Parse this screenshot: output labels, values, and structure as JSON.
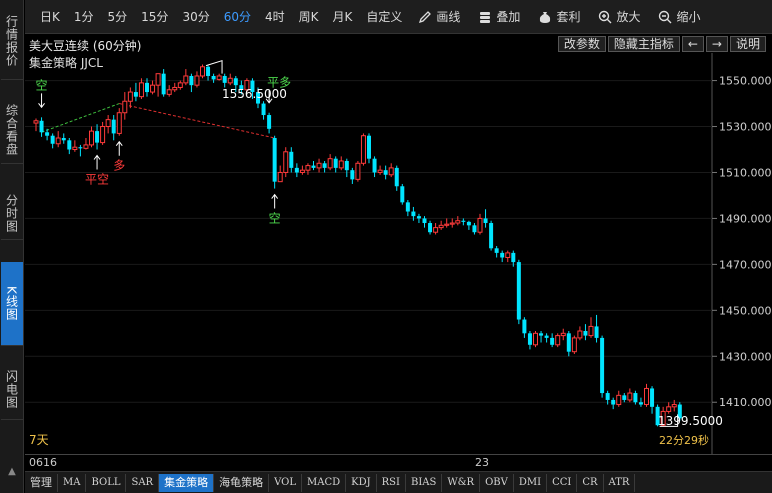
{
  "left_nav": {
    "items": [
      {
        "label": "行情报价",
        "active": false
      },
      {
        "label": "综合看盘",
        "active": false
      },
      {
        "label": "分时图",
        "active": false
      },
      {
        "label": "K线图",
        "active": true
      },
      {
        "label": "闪电图",
        "active": false
      }
    ]
  },
  "toolbar": {
    "periods": [
      "日K",
      "1分",
      "5分",
      "15分",
      "30分",
      "60分",
      "4时",
      "周K",
      "月K",
      "自定义"
    ],
    "active_period": "60分",
    "tools": [
      {
        "label": "画线",
        "icon": "pencil-icon"
      },
      {
        "label": "叠加",
        "icon": "stack-icon"
      },
      {
        "label": "套利",
        "icon": "moneybag-icon"
      },
      {
        "label": "放大",
        "icon": "zoom-in-icon"
      },
      {
        "label": "缩小",
        "icon": "zoom-out-icon"
      }
    ]
  },
  "header": {
    "title": "美大豆连续 (60分钟)",
    "buttons": [
      "改参数",
      "隐藏主指标",
      "←",
      "→",
      "说明"
    ]
  },
  "strategy_label": "集金策略 JJCL",
  "period_label": "7天",
  "countdown": "22分29秒",
  "peak_label": "1556.5000",
  "last_label": "1399.5000",
  "date_axis": {
    "start": "0616",
    "mid": "23"
  },
  "bottom_tabs": {
    "items": [
      "管理",
      "MA",
      "BOLL",
      "SAR",
      "集金策略",
      "海龟策略",
      "VOL",
      "MACD",
      "KDJ",
      "RSI",
      "BIAS",
      "W&R",
      "OBV",
      "DMI",
      "CCI",
      "CR",
      "ATR"
    ],
    "active": "集金策略"
  },
  "colors": {
    "up": "#ff3b3b",
    "down": "#00e5ff",
    "signal_short": "#4dd84d",
    "signal_long": "#ff3b3b",
    "accent": "#1e72c8"
  },
  "chart_data": {
    "type": "candlestick",
    "title": "美大豆连续 (60分钟)",
    "ylim": [
      1394,
      1562
    ],
    "yticks": [
      "1550.0000",
      "1530.0000",
      "1510.0000",
      "1490.0000",
      "1470.0000",
      "1450.0000",
      "1430.0000",
      "1410.0000"
    ],
    "high_marker": 1556.5,
    "low_marker": 1399.5,
    "signals": [
      {
        "label": "空",
        "bar": 1,
        "side": "short"
      },
      {
        "label": "平空",
        "bar": 11,
        "side": "long"
      },
      {
        "label": "多",
        "bar": 15,
        "side": "long"
      },
      {
        "label": "平多",
        "bar": 42,
        "side": "short"
      },
      {
        "label": "空",
        "bar": 43,
        "side": "short"
      }
    ],
    "candles": [
      [
        1531.5,
        1532.5,
        1528,
        1533.5
      ],
      [
        1532.5,
        1527.5,
        1525.5,
        1534
      ],
      [
        1527.5,
        1526,
        1524,
        1529
      ],
      [
        1526,
        1522.5,
        1520.5,
        1527
      ],
      [
        1522.5,
        1525,
        1521,
        1528
      ],
      [
        1525,
        1524,
        1522.5,
        1527
      ],
      [
        1524,
        1520,
        1518,
        1525
      ],
      [
        1520,
        1521,
        1519,
        1524
      ],
      [
        1521,
        1520.5,
        1517,
        1522
      ],
      [
        1520.5,
        1522,
        1520,
        1525
      ],
      [
        1522,
        1528,
        1521,
        1530
      ],
      [
        1528,
        1523,
        1520,
        1531
      ],
      [
        1523,
        1530,
        1522,
        1532
      ],
      [
        1530,
        1533,
        1527,
        1535
      ],
      [
        1533,
        1527,
        1524,
        1535
      ],
      [
        1527,
        1536,
        1526,
        1538
      ],
      [
        1536,
        1541,
        1533,
        1545
      ],
      [
        1541,
        1545,
        1538,
        1547
      ],
      [
        1545,
        1543,
        1541,
        1549
      ],
      [
        1543,
        1549,
        1542,
        1551
      ],
      [
        1549,
        1545,
        1543,
        1551
      ],
      [
        1545,
        1548,
        1544,
        1550
      ],
      [
        1548,
        1553,
        1543,
        1553
      ],
      [
        1553,
        1544,
        1543,
        1555
      ],
      [
        1544,
        1546,
        1543,
        1548
      ],
      [
        1546,
        1547,
        1545,
        1549
      ],
      [
        1547,
        1549,
        1546,
        1550
      ],
      [
        1549,
        1552,
        1548,
        1555
      ],
      [
        1552,
        1548,
        1545,
        1553
      ],
      [
        1548,
        1552,
        1547,
        1554
      ],
      [
        1552,
        1556,
        1551,
        1557
      ],
      [
        1556,
        1552,
        1550,
        1556.5
      ],
      [
        1552,
        1550.5,
        1549,
        1553
      ],
      [
        1550.5,
        1552,
        1550,
        1553
      ],
      [
        1552,
        1549,
        1547,
        1553
      ],
      [
        1549,
        1551,
        1548,
        1553
      ],
      [
        1551,
        1548,
        1545,
        1552
      ],
      [
        1548,
        1546,
        1544,
        1550
      ],
      [
        1546,
        1550,
        1545,
        1551
      ],
      [
        1550,
        1545,
        1542,
        1551
      ],
      [
        1545,
        1540,
        1538,
        1547
      ],
      [
        1540,
        1535,
        1533,
        1541
      ],
      [
        1535,
        1529,
        1527,
        1536
      ],
      [
        1525,
        1506,
        1503,
        1526
      ],
      [
        1506,
        1510,
        1506,
        1513
      ],
      [
        1510,
        1519,
        1508,
        1521
      ],
      [
        1519,
        1512,
        1510,
        1521
      ],
      [
        1512,
        1510,
        1508,
        1514
      ],
      [
        1510,
        1511,
        1509,
        1513
      ],
      [
        1511,
        1513,
        1509,
        1514
      ],
      [
        1513,
        1512,
        1511,
        1515
      ],
      [
        1512,
        1514,
        1510,
        1516
      ],
      [
        1514,
        1512,
        1510,
        1515
      ],
      [
        1512,
        1516,
        1511,
        1518
      ],
      [
        1516,
        1512,
        1510,
        1517
      ],
      [
        1512,
        1515,
        1511,
        1517
      ],
      [
        1515,
        1511,
        1508,
        1516
      ],
      [
        1511,
        1507,
        1505,
        1512
      ],
      [
        1507,
        1514,
        1506,
        1515
      ],
      [
        1514,
        1526,
        1513,
        1527
      ],
      [
        1526,
        1516,
        1514,
        1527
      ],
      [
        1516,
        1510,
        1508,
        1517
      ],
      [
        1510,
        1511,
        1509,
        1513
      ],
      [
        1511,
        1509,
        1507,
        1513
      ],
      [
        1509,
        1512,
        1508,
        1514
      ],
      [
        1512,
        1504,
        1502,
        1513
      ],
      [
        1504,
        1497,
        1496,
        1505
      ],
      [
        1497,
        1493,
        1491,
        1498
      ],
      [
        1493,
        1491,
        1489,
        1495
      ],
      [
        1491,
        1490,
        1488,
        1492
      ],
      [
        1490,
        1488,
        1486,
        1491
      ],
      [
        1488,
        1484,
        1483,
        1489
      ],
      [
        1484,
        1486,
        1483,
        1488
      ],
      [
        1486,
        1487,
        1485,
        1489
      ],
      [
        1487,
        1487.5,
        1486,
        1490
      ],
      [
        1487.5,
        1488,
        1486,
        1490
      ],
      [
        1488,
        1489,
        1487,
        1491
      ],
      [
        1489,
        1488.5,
        1487,
        1490
      ],
      [
        1488.5,
        1487,
        1485,
        1489
      ],
      [
        1487,
        1484,
        1483,
        1488
      ],
      [
        1484,
        1490,
        1483,
        1492
      ],
      [
        1490,
        1488,
        1486,
        1494
      ],
      [
        1488,
        1477,
        1476,
        1489
      ],
      [
        1477,
        1475,
        1473,
        1478
      ],
      [
        1475,
        1473,
        1471,
        1476
      ],
      [
        1473,
        1475,
        1471,
        1476
      ],
      [
        1475,
        1471,
        1469,
        1476
      ],
      [
        1471,
        1446,
        1444,
        1472
      ],
      [
        1446,
        1440,
        1438,
        1447
      ],
      [
        1440,
        1435,
        1433,
        1441
      ],
      [
        1435,
        1440,
        1434,
        1441
      ],
      [
        1440,
        1439,
        1436,
        1441
      ],
      [
        1439,
        1438,
        1436,
        1440
      ],
      [
        1438,
        1435,
        1434,
        1440
      ],
      [
        1435,
        1439,
        1434,
        1440
      ],
      [
        1439,
        1440,
        1437,
        1442
      ],
      [
        1440,
        1432,
        1430,
        1441
      ],
      [
        1432,
        1438,
        1431,
        1439
      ],
      [
        1438,
        1441,
        1437,
        1443
      ],
      [
        1441,
        1439,
        1437,
        1444
      ],
      [
        1439,
        1443,
        1438,
        1447
      ],
      [
        1443,
        1438,
        1436,
        1448
      ],
      [
        1438,
        1414,
        1412,
        1439
      ],
      [
        1414,
        1411,
        1409,
        1415
      ],
      [
        1411,
        1409,
        1407,
        1412
      ],
      [
        1409,
        1413,
        1408,
        1415
      ],
      [
        1413,
        1411,
        1410,
        1414
      ],
      [
        1411,
        1414,
        1410,
        1416
      ],
      [
        1414,
        1410,
        1409,
        1415
      ],
      [
        1410,
        1409,
        1408,
        1412
      ],
      [
        1409,
        1416,
        1408,
        1418
      ],
      [
        1416,
        1408,
        1405,
        1417
      ],
      [
        1408,
        1400,
        1399.5,
        1409
      ],
      [
        1400,
        1406,
        1399.5,
        1408
      ],
      [
        1406,
        1408,
        1405,
        1410
      ],
      [
        1408,
        1409,
        1406,
        1411
      ],
      [
        1409,
        1403,
        1402,
        1410
      ]
    ]
  }
}
